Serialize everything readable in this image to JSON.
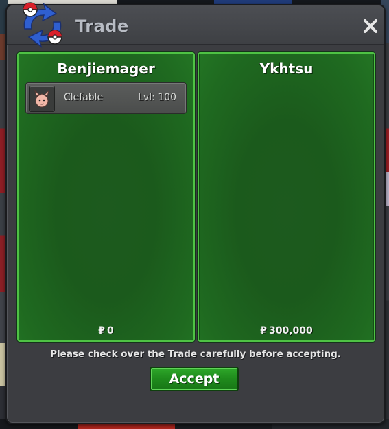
{
  "window": {
    "title": "Trade",
    "icon": "trade-pokeball-arrows-icon",
    "close_icon": "close-icon"
  },
  "left_panel": {
    "player_name": "Benjiemager",
    "items": [
      {
        "name": "Clefable",
        "level": "Lvl: 100",
        "icon": "clefable-icon"
      }
    ],
    "money_symbol": "₽",
    "money": "0"
  },
  "right_panel": {
    "player_name": "Ykhtsu",
    "items": [],
    "money_symbol": "₽",
    "money": "300,000"
  },
  "footer": {
    "notice": "Please check over the Trade carefully before accepting.",
    "accept_label": "Accept"
  },
  "colors": {
    "panel_border": "#4ec244",
    "panel_fill": "#1d5a1e",
    "accept_button": "#1f8a1c",
    "window_bg": "#3c3d41"
  }
}
